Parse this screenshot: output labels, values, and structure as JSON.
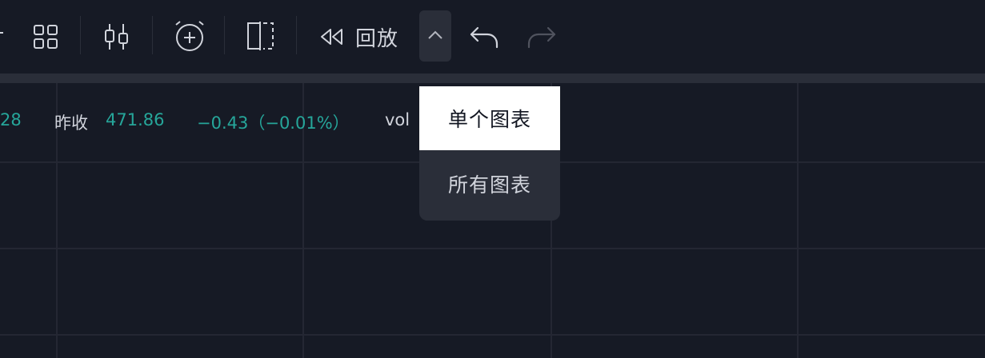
{
  "toolbar": {
    "icons": [
      "layout-grid-icon",
      "candlestick-icon",
      "alert-clock-icon",
      "split-view-icon",
      "rewind-icon",
      "chevron-up-icon",
      "undo-icon",
      "redo-icon"
    ],
    "replay_label": "回放"
  },
  "legend": {
    "partial_value": "28",
    "prev_close_label": "昨收",
    "prev_close_value": "471.86",
    "change_text": "−0.43（−0.01%）",
    "vol_label": "vol"
  },
  "dropdown": {
    "items": [
      {
        "label": "单个图表",
        "selected": true
      },
      {
        "label": "所有图表",
        "selected": false
      }
    ]
  },
  "colors": {
    "background": "#161a25",
    "toolbar_band": "#2a2e39",
    "grid": "#242733",
    "text": "#d1d4dc",
    "accent_teal": "#26a69a",
    "disabled": "#50535e",
    "selected_bg": "#ffffff"
  }
}
